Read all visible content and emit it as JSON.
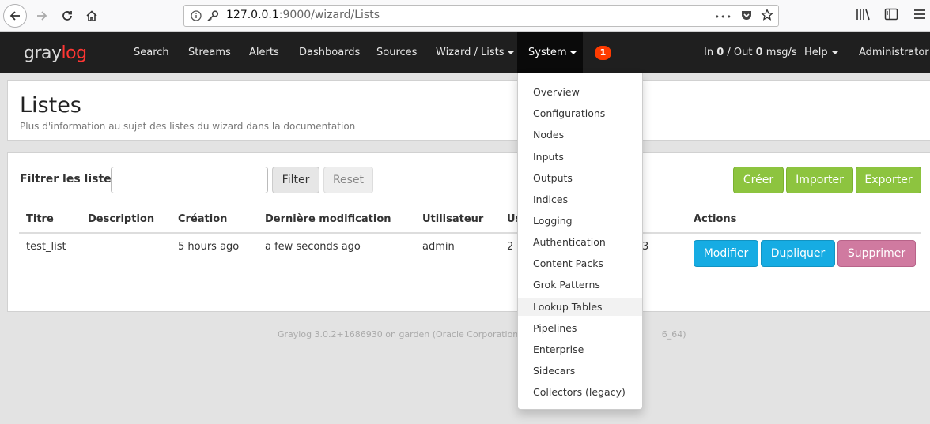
{
  "browser": {
    "url_host": "127.0.0.1",
    "url_rest": ":9000/wizard/Lists",
    "more_label": "•••"
  },
  "navbar": {
    "brand_gray": "gray",
    "brand_red": "log",
    "items": [
      {
        "label": "Search"
      },
      {
        "label": "Streams"
      },
      {
        "label": "Alerts"
      },
      {
        "label": "Dashboards"
      },
      {
        "label": "Sources"
      },
      {
        "label": "Wizard / Lists"
      },
      {
        "label": "System"
      }
    ],
    "notification_count": "1",
    "throughput": {
      "prefix": "In ",
      "in": "0",
      "mid": " / Out ",
      "out": "0",
      "suffix": " msg/s"
    },
    "help_label": "Help",
    "user_label": "Administrator",
    "accent_color": "#ff3633",
    "active_bg": "#0a0a0a"
  },
  "page": {
    "title": "Listes",
    "description": "Plus d'information au sujet des listes du wizard dans la documentation"
  },
  "filter": {
    "label": "Filtrer les listes",
    "input_value": "",
    "filter_label": "Filter",
    "reset_label": "Reset"
  },
  "actions": {
    "create_label": "Créer",
    "import_label": "Importer",
    "export_label": "Exporter",
    "green": "#8dc43f"
  },
  "table": {
    "headers": [
      "Titre",
      "Description",
      "Création",
      "Dernière modification",
      "Utilisateur",
      "Us",
      "Actions"
    ],
    "rows": [
      {
        "title": "test_list",
        "description": "",
        "created": "5 hours ago",
        "modified": "a few seconds ago",
        "user": "admin",
        "usage": "2",
        "fields": "3"
      }
    ],
    "edit_label": "Modifier",
    "duplicate_label": "Dupliquer",
    "delete_label": "Supprimer",
    "blue": "#16ace3",
    "pink": "#d07aa0"
  },
  "footer": {
    "text": "Graylog 3.0.2+1686930 on garden (Oracle Corporation 1.8.0",
    "text_end": "6_64)"
  },
  "system_menu": {
    "items": [
      {
        "label": "Overview"
      },
      {
        "label": "Configurations"
      },
      {
        "label": "Nodes"
      },
      {
        "label": "Inputs"
      },
      {
        "label": "Outputs"
      },
      {
        "label": "Indices"
      },
      {
        "label": "Logging"
      },
      {
        "label": "Authentication"
      },
      {
        "label": "Content Packs"
      },
      {
        "label": "Grok Patterns"
      },
      {
        "label": "Lookup Tables"
      },
      {
        "label": "Pipelines"
      },
      {
        "label": "Enterprise"
      },
      {
        "label": "Sidecars"
      },
      {
        "label": "Collectors (legacy)"
      }
    ],
    "hovered": "Lookup Tables"
  }
}
